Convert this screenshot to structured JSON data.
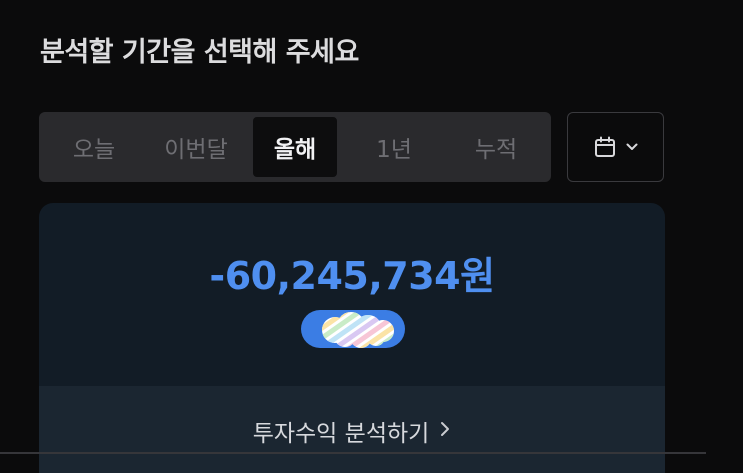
{
  "heading": "분석할 기간을 선택해 주세요",
  "period_tabs": [
    {
      "label": "오늘",
      "active": false
    },
    {
      "label": "이번달",
      "active": false
    },
    {
      "label": "올해",
      "active": true
    },
    {
      "label": "1년",
      "active": false
    },
    {
      "label": "누적",
      "active": false
    }
  ],
  "calendar_button": {
    "icon": "calendar-icon",
    "dropdown_icon": "chevron-down-icon"
  },
  "summary": {
    "amount": "-60,245,734원",
    "amount_color": "#4f8ff0",
    "masked_content_icon": "rainbow-mask-sticker",
    "analyze_link_label": "투자수익 분석하기",
    "analyze_link_icon": "chevron-right-icon"
  },
  "colors": {
    "background": "#0b0b0c",
    "card": "#121c26",
    "card_footer": "#1b2631",
    "tab_bar": "#2a2a2d"
  }
}
